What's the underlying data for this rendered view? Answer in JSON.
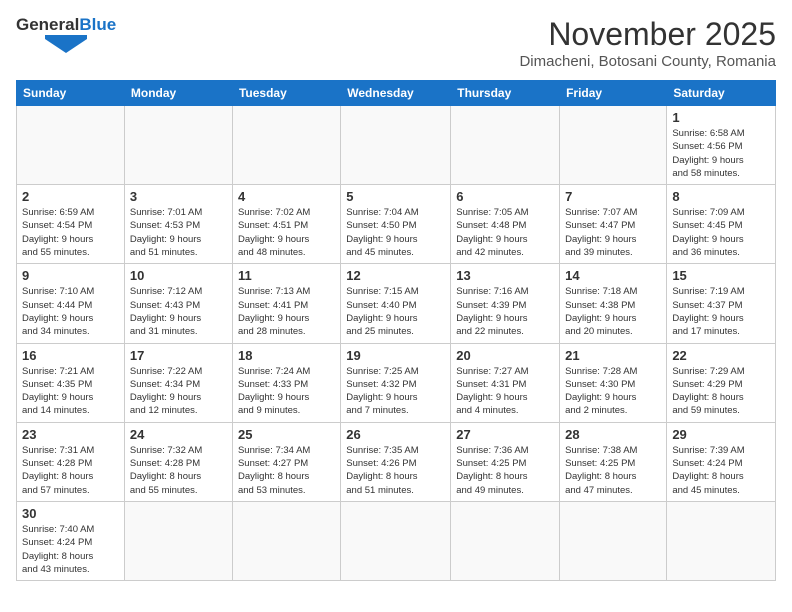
{
  "header": {
    "logo_general": "General",
    "logo_blue": "Blue",
    "month_title": "November 2025",
    "subtitle": "Dimacheni, Botosani County, Romania"
  },
  "weekdays": [
    "Sunday",
    "Monday",
    "Tuesday",
    "Wednesday",
    "Thursday",
    "Friday",
    "Saturday"
  ],
  "weeks": [
    [
      {
        "day": "",
        "info": ""
      },
      {
        "day": "",
        "info": ""
      },
      {
        "day": "",
        "info": ""
      },
      {
        "day": "",
        "info": ""
      },
      {
        "day": "",
        "info": ""
      },
      {
        "day": "",
        "info": ""
      },
      {
        "day": "1",
        "info": "Sunrise: 6:58 AM\nSunset: 4:56 PM\nDaylight: 9 hours\nand 58 minutes."
      }
    ],
    [
      {
        "day": "2",
        "info": "Sunrise: 6:59 AM\nSunset: 4:54 PM\nDaylight: 9 hours\nand 55 minutes."
      },
      {
        "day": "3",
        "info": "Sunrise: 7:01 AM\nSunset: 4:53 PM\nDaylight: 9 hours\nand 51 minutes."
      },
      {
        "day": "4",
        "info": "Sunrise: 7:02 AM\nSunset: 4:51 PM\nDaylight: 9 hours\nand 48 minutes."
      },
      {
        "day": "5",
        "info": "Sunrise: 7:04 AM\nSunset: 4:50 PM\nDaylight: 9 hours\nand 45 minutes."
      },
      {
        "day": "6",
        "info": "Sunrise: 7:05 AM\nSunset: 4:48 PM\nDaylight: 9 hours\nand 42 minutes."
      },
      {
        "day": "7",
        "info": "Sunrise: 7:07 AM\nSunset: 4:47 PM\nDaylight: 9 hours\nand 39 minutes."
      },
      {
        "day": "8",
        "info": "Sunrise: 7:09 AM\nSunset: 4:45 PM\nDaylight: 9 hours\nand 36 minutes."
      }
    ],
    [
      {
        "day": "9",
        "info": "Sunrise: 7:10 AM\nSunset: 4:44 PM\nDaylight: 9 hours\nand 34 minutes."
      },
      {
        "day": "10",
        "info": "Sunrise: 7:12 AM\nSunset: 4:43 PM\nDaylight: 9 hours\nand 31 minutes."
      },
      {
        "day": "11",
        "info": "Sunrise: 7:13 AM\nSunset: 4:41 PM\nDaylight: 9 hours\nand 28 minutes."
      },
      {
        "day": "12",
        "info": "Sunrise: 7:15 AM\nSunset: 4:40 PM\nDaylight: 9 hours\nand 25 minutes."
      },
      {
        "day": "13",
        "info": "Sunrise: 7:16 AM\nSunset: 4:39 PM\nDaylight: 9 hours\nand 22 minutes."
      },
      {
        "day": "14",
        "info": "Sunrise: 7:18 AM\nSunset: 4:38 PM\nDaylight: 9 hours\nand 20 minutes."
      },
      {
        "day": "15",
        "info": "Sunrise: 7:19 AM\nSunset: 4:37 PM\nDaylight: 9 hours\nand 17 minutes."
      }
    ],
    [
      {
        "day": "16",
        "info": "Sunrise: 7:21 AM\nSunset: 4:35 PM\nDaylight: 9 hours\nand 14 minutes."
      },
      {
        "day": "17",
        "info": "Sunrise: 7:22 AM\nSunset: 4:34 PM\nDaylight: 9 hours\nand 12 minutes."
      },
      {
        "day": "18",
        "info": "Sunrise: 7:24 AM\nSunset: 4:33 PM\nDaylight: 9 hours\nand 9 minutes."
      },
      {
        "day": "19",
        "info": "Sunrise: 7:25 AM\nSunset: 4:32 PM\nDaylight: 9 hours\nand 7 minutes."
      },
      {
        "day": "20",
        "info": "Sunrise: 7:27 AM\nSunset: 4:31 PM\nDaylight: 9 hours\nand 4 minutes."
      },
      {
        "day": "21",
        "info": "Sunrise: 7:28 AM\nSunset: 4:30 PM\nDaylight: 9 hours\nand 2 minutes."
      },
      {
        "day": "22",
        "info": "Sunrise: 7:29 AM\nSunset: 4:29 PM\nDaylight: 8 hours\nand 59 minutes."
      }
    ],
    [
      {
        "day": "23",
        "info": "Sunrise: 7:31 AM\nSunset: 4:28 PM\nDaylight: 8 hours\nand 57 minutes."
      },
      {
        "day": "24",
        "info": "Sunrise: 7:32 AM\nSunset: 4:28 PM\nDaylight: 8 hours\nand 55 minutes."
      },
      {
        "day": "25",
        "info": "Sunrise: 7:34 AM\nSunset: 4:27 PM\nDaylight: 8 hours\nand 53 minutes."
      },
      {
        "day": "26",
        "info": "Sunrise: 7:35 AM\nSunset: 4:26 PM\nDaylight: 8 hours\nand 51 minutes."
      },
      {
        "day": "27",
        "info": "Sunrise: 7:36 AM\nSunset: 4:25 PM\nDaylight: 8 hours\nand 49 minutes."
      },
      {
        "day": "28",
        "info": "Sunrise: 7:38 AM\nSunset: 4:25 PM\nDaylight: 8 hours\nand 47 minutes."
      },
      {
        "day": "29",
        "info": "Sunrise: 7:39 AM\nSunset: 4:24 PM\nDaylight: 8 hours\nand 45 minutes."
      }
    ],
    [
      {
        "day": "30",
        "info": "Sunrise: 7:40 AM\nSunset: 4:24 PM\nDaylight: 8 hours\nand 43 minutes."
      },
      {
        "day": "",
        "info": ""
      },
      {
        "day": "",
        "info": ""
      },
      {
        "day": "",
        "info": ""
      },
      {
        "day": "",
        "info": ""
      },
      {
        "day": "",
        "info": ""
      },
      {
        "day": "",
        "info": ""
      }
    ]
  ]
}
